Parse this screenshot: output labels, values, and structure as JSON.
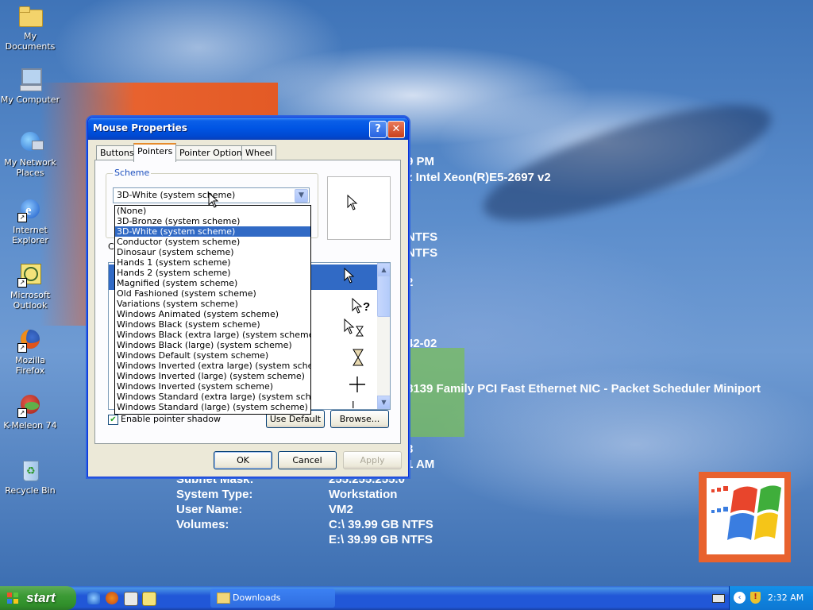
{
  "desktop": {
    "icons": [
      {
        "label": "My Documents"
      },
      {
        "label": "My Computer"
      },
      {
        "label": "My Network Places"
      },
      {
        "label": "Internet Explorer"
      },
      {
        "label": "Microsoft Outlook"
      },
      {
        "label": "Mozilla Firefox"
      },
      {
        "label": "K-Meleon 74"
      },
      {
        "label": "Recycle Bin"
      }
    ],
    "info_lines": [
      "9 PM",
      "z Intel Xeon(R)E5-2697 v2",
      "NTFS",
      "NTFS",
      "2",
      "42-02",
      "8139 Family PCI Fast Ethernet NIC - Packet Scheduler Miniport",
      "3",
      "1 AM"
    ],
    "info_table": [
      {
        "label": "Subnet Mask:",
        "value": "255.255.255.0"
      },
      {
        "label": "System Type:",
        "value": "Workstation"
      },
      {
        "label": "User Name:",
        "value": "VM2"
      },
      {
        "label": "Volumes:",
        "value": "C:\\ 39.99 GB NTFS"
      },
      {
        "label": "",
        "value": "E:\\ 39.99 GB NTFS"
      }
    ]
  },
  "dialog": {
    "title": "Mouse Properties",
    "help_glyph": "?",
    "close_glyph": "✕",
    "tabs": [
      "Buttons",
      "Pointers",
      "Pointer Options",
      "Wheel"
    ],
    "active_tab": "Pointers",
    "scheme_label": "Scheme",
    "scheme_value": "3D-White (system scheme)",
    "customize_label_partial": "C",
    "dropdown_items": [
      "(None)",
      "3D-Bronze (system scheme)",
      "3D-White (system scheme)",
      "Conductor (system scheme)",
      "Dinosaur (system scheme)",
      "Hands 1 (system scheme)",
      "Hands 2 (system scheme)",
      "Magnified (system scheme)",
      "Old Fashioned (system scheme)",
      "Variations (system scheme)",
      "Windows Animated (system scheme)",
      "Windows Black  (system scheme)",
      "Windows Black (extra large) (system scheme)",
      "Windows Black (large) (system scheme)",
      "Windows Default (system scheme)",
      "Windows Inverted (extra large) (system scheme)",
      "Windows Inverted (large) (system scheme)",
      "Windows Inverted (system scheme)",
      "Windows Standard (extra large) (system scheme)",
      "Windows Standard (large) (system scheme)"
    ],
    "selected_dropdown_index": 2,
    "enable_shadow_label": "Enable pointer shadow",
    "enable_shadow_checked": true,
    "use_default_label": "Use Default",
    "browse_label": "Browse...",
    "ok_label": "OK",
    "cancel_label": "Cancel",
    "apply_label": "Apply"
  },
  "taskbar": {
    "start_label": "start",
    "task_label": "Downloads",
    "clock": "2:32 AM"
  }
}
